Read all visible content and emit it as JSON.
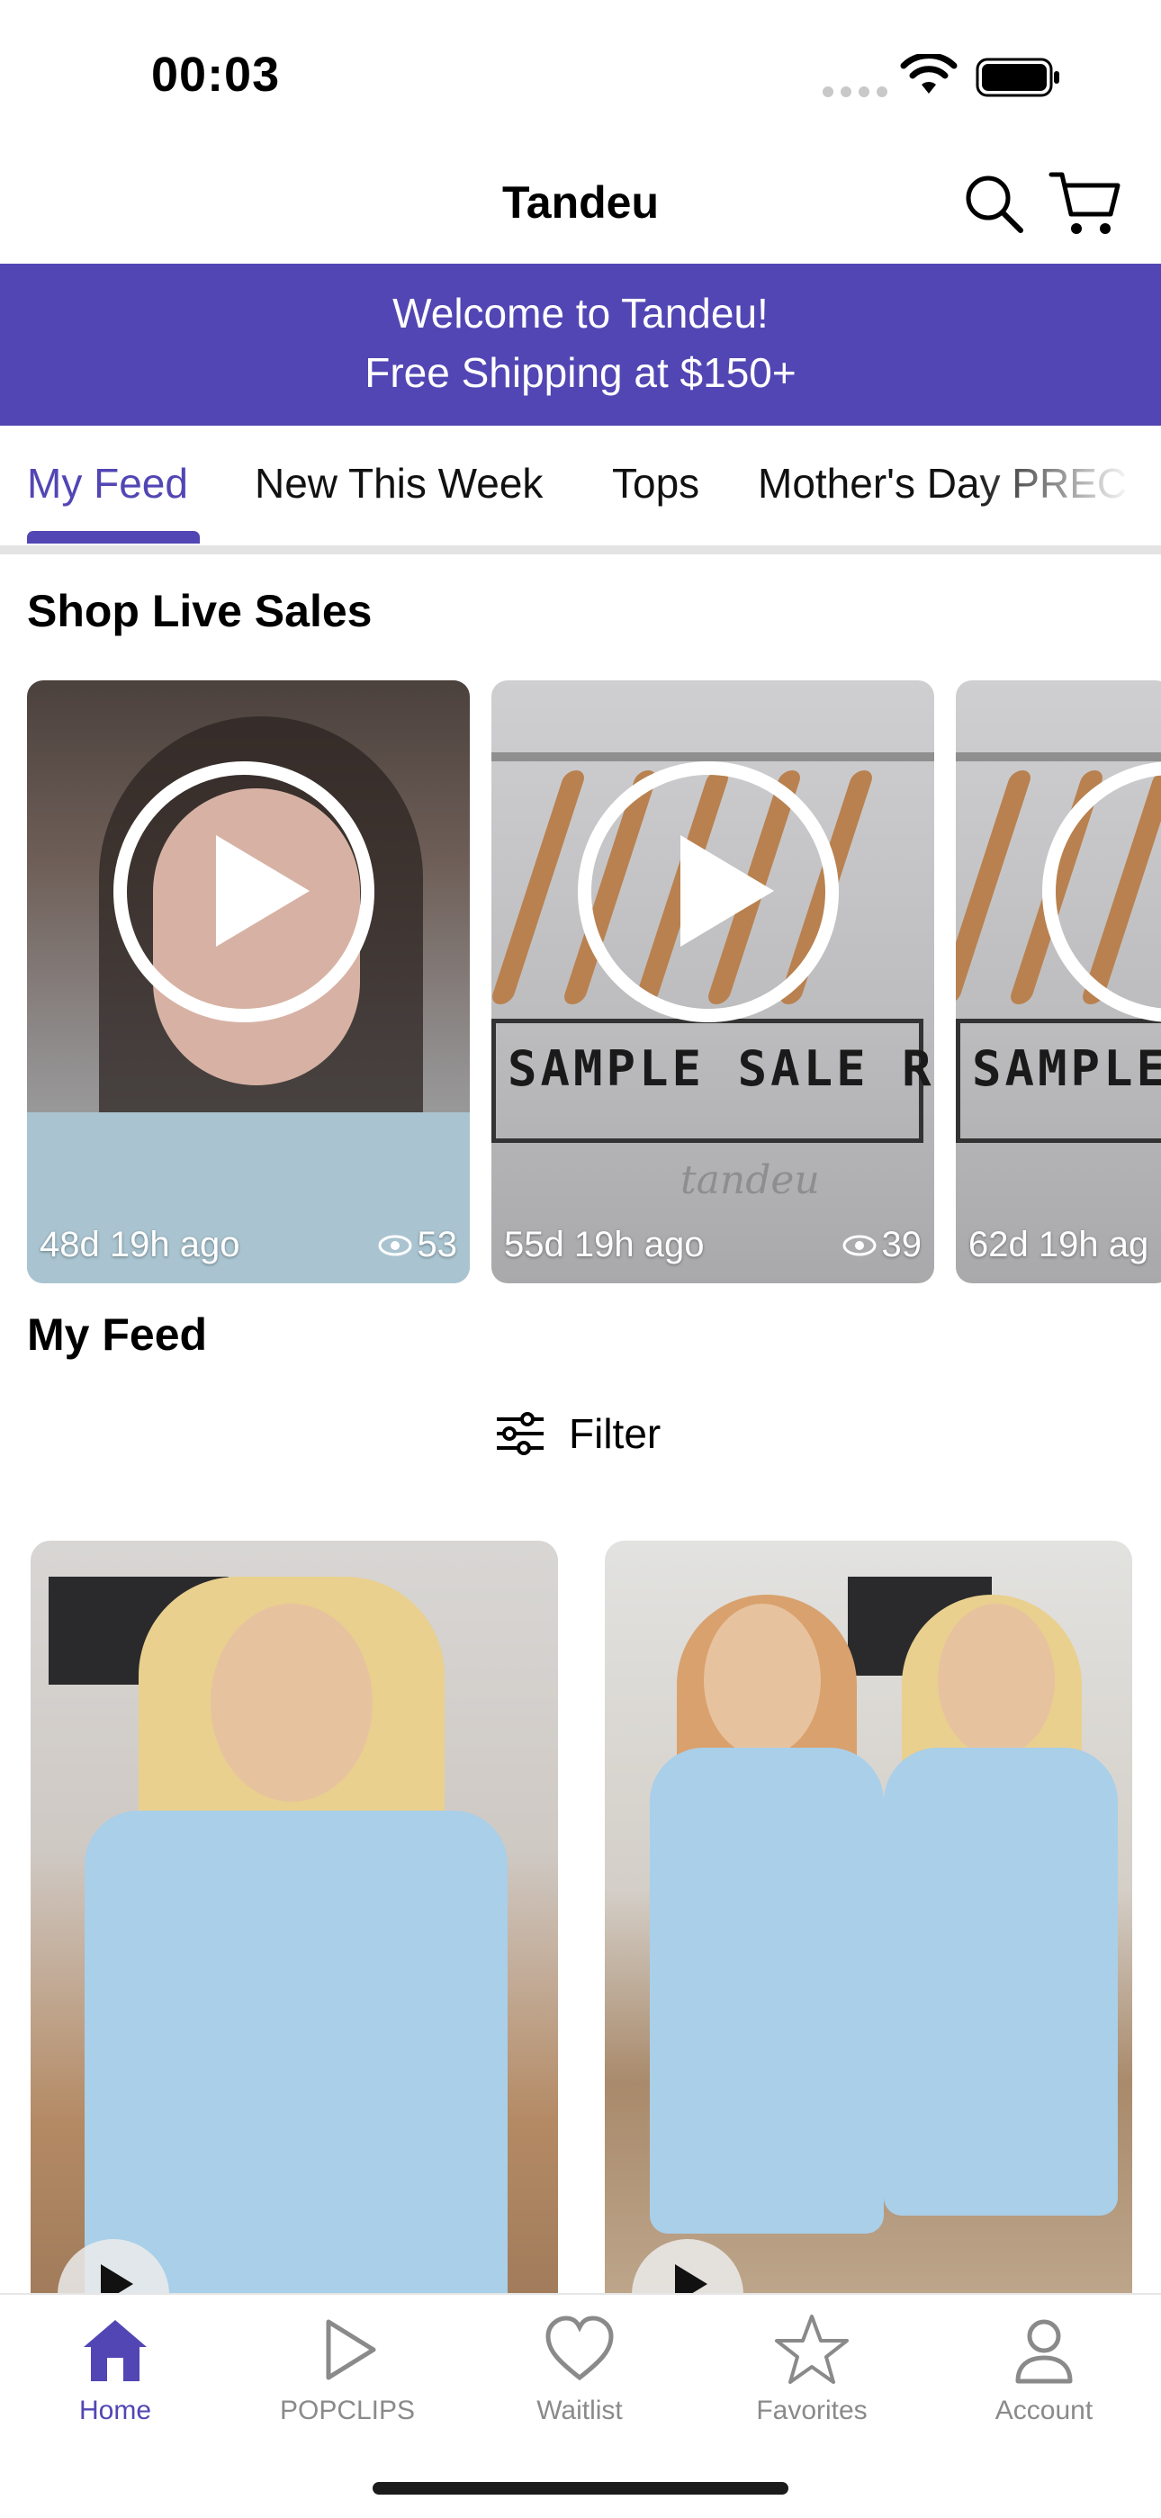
{
  "status_bar": {
    "time": "00:03"
  },
  "header": {
    "title": "Tandeu",
    "search_icon": "search-icon",
    "cart_icon": "cart-icon"
  },
  "banner": {
    "line1": "Welcome to Tandeu!",
    "line2": "Free Shipping at $150+",
    "color": "#5246b4"
  },
  "tabs": [
    {
      "label": "My Feed",
      "active": true
    },
    {
      "label": "New This Week"
    },
    {
      "label": "Tops"
    },
    {
      "label": "Mother's Day PREC"
    }
  ],
  "live_section": {
    "title": "Shop Live Sales",
    "cards": [
      {
        "time": "48d 19h ago",
        "views": "53"
      },
      {
        "time": "55d 19h ago",
        "views": "39",
        "overlay_text": "SAMPLE SALE RECAP",
        "watermark": "tandeu"
      },
      {
        "time": "62d 19h ag",
        "overlay_text": "SAMPLE S"
      }
    ]
  },
  "feed": {
    "title": "My Feed",
    "filter_label": "Filter"
  },
  "bottom_nav": [
    {
      "label": "Home",
      "icon": "home-icon",
      "active": true
    },
    {
      "label": "POPCLIPS",
      "icon": "play-icon"
    },
    {
      "label": "Waitlist",
      "icon": "heart-icon"
    },
    {
      "label": "Favorites",
      "icon": "star-icon"
    },
    {
      "label": "Account",
      "icon": "account-icon"
    }
  ]
}
